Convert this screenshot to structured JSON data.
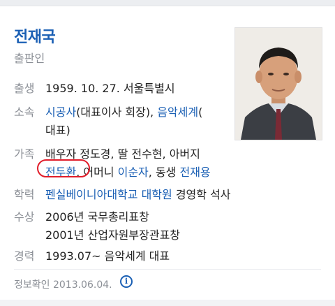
{
  "profile": {
    "name": "전재국",
    "subtitle": "출판인"
  },
  "rows": [
    {
      "label": "출생",
      "value": "1959. 10. 27. 서울특별시"
    },
    {
      "label": "소속",
      "link1": "시공사",
      "text1": "(대표이사 회장), ",
      "link2": "음악세계",
      "text2": "(",
      "line2": "대표)"
    },
    {
      "label": "가족",
      "line1": "배우자 정도경, 딸 전수현, 아버지",
      "link1": "전두환",
      "text1": ", 어머니 ",
      "link2": "이순자",
      "text2": ", 동생 ",
      "link3": "전재용"
    },
    {
      "label": "학력",
      "link1": "펜실베이니아대학교 대학원",
      "text1": " 경영학 석사"
    },
    {
      "label": "수상",
      "line1": "2006년 국무총리표창",
      "line2": "2001년 산업자원부장관표창"
    },
    {
      "label": "경력",
      "value": "1993.07~ 음악세계 대표"
    }
  ],
  "footer": {
    "text": "정보확인 2013.06.04.",
    "icon": "info-icon",
    "icon_glyph": "i"
  },
  "colors": {
    "link": "#1a5fb4",
    "label": "#8b8f96",
    "highlight_circle": "#e11d2a"
  }
}
